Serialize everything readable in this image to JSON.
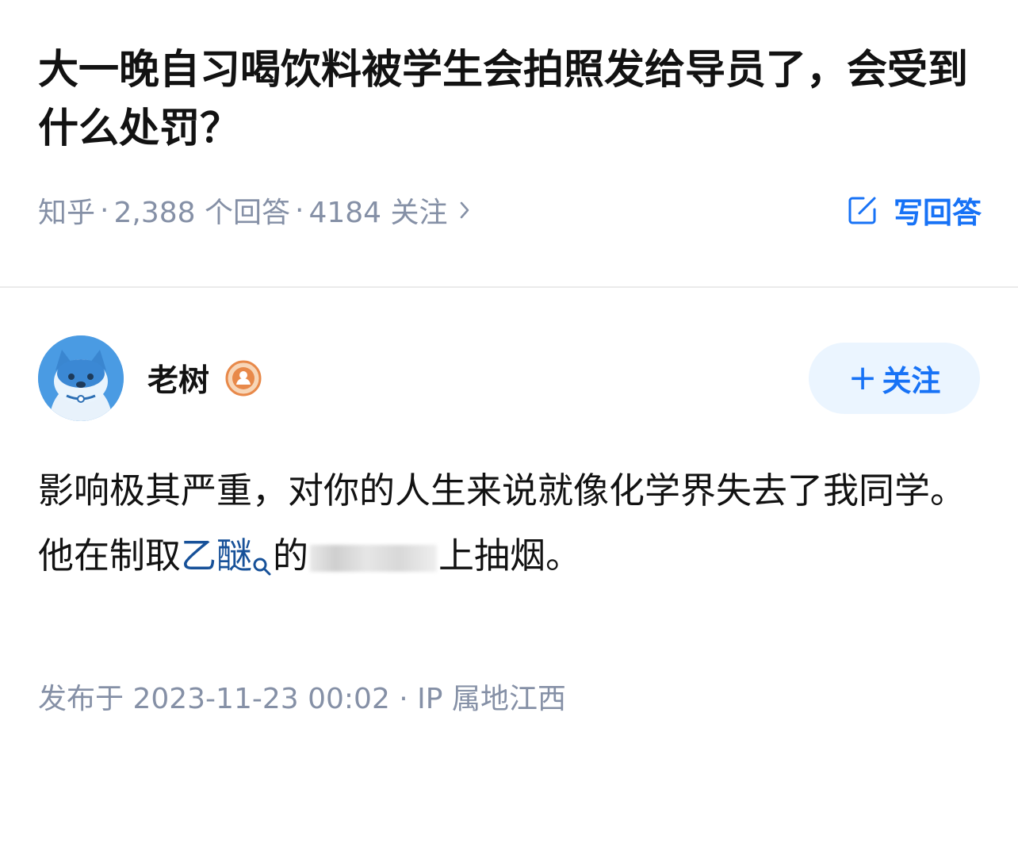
{
  "question": {
    "title": "大一晚自习喝饮料被学生会拍照发给导员了，会受到什么处罚？",
    "source": "知乎",
    "answers_count": "2,388 个回答",
    "followers_count": "4184 关注",
    "write_answer_label": "写回答"
  },
  "author": {
    "name": "老树",
    "follow_label": "关注"
  },
  "answer": {
    "paragraph_1": "影响极其严重，对你的人生来说就像化学界失去了我同学。",
    "paragraph_2_prefix": "他在制取",
    "keyword": "乙醚",
    "paragraph_2_mid": "的",
    "paragraph_2_suffix": "上抽烟。",
    "published": "发布于 2023-11-23 00:02 · IP 属地江西"
  },
  "colors": {
    "accent": "#1772f6",
    "link": "#175199",
    "meta_text": "#8590a6",
    "follow_bg": "#ebf5ff"
  },
  "icons": [
    "edit-icon",
    "chevron-right-icon",
    "plus-icon",
    "search-icon",
    "badge-icon"
  ]
}
